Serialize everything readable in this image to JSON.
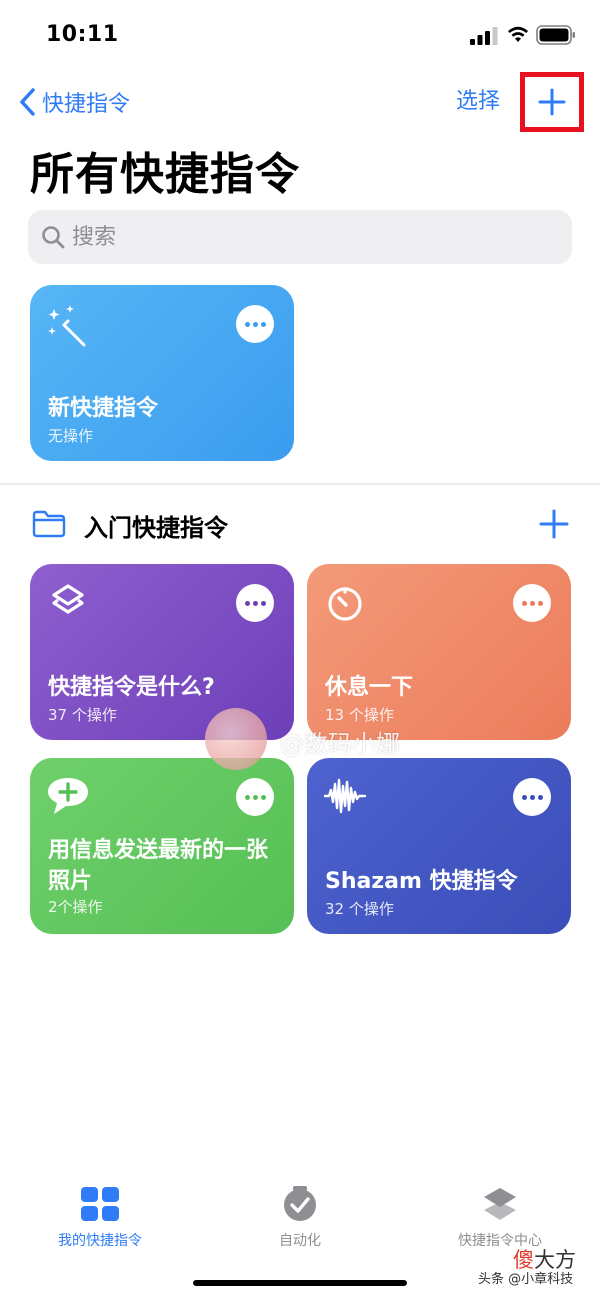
{
  "status_bar": {
    "time": "10:11"
  },
  "nav": {
    "back_label": "快捷指令",
    "select_label": "选择"
  },
  "page_title": "所有快捷指令",
  "search": {
    "placeholder": "搜索"
  },
  "top_card": {
    "title": "新快捷指令",
    "subtitle": "无操作",
    "color": "#4aaaf3",
    "icon": "sparkles-icon"
  },
  "section": {
    "title": "入门快捷指令",
    "icon": "folder-icon"
  },
  "cards": [
    {
      "title": "快捷指令是什么?",
      "subtitle": "37 个操作",
      "color": "#7d4fc4",
      "icon": "layers-icon"
    },
    {
      "title": "休息一下",
      "subtitle": "13 个操作",
      "color": "#f08b6a",
      "icon": "timer-icon"
    },
    {
      "title": "用信息发送最新的一张照片",
      "subtitle": "2个操作",
      "color": "#62c761",
      "icon": "message-plus-icon"
    },
    {
      "title": "Shazam 快捷指令",
      "subtitle": "32 个操作",
      "color": "#4457c4",
      "icon": "waveform-icon"
    }
  ],
  "watermark": {
    "text": "@数码小娜"
  },
  "tabs": [
    {
      "label": "我的快捷指令",
      "icon": "grid-icon",
      "active": true
    },
    {
      "label": "自动化",
      "icon": "clock-check-icon",
      "active": false
    },
    {
      "label": "快捷指令中心",
      "icon": "stack-icon",
      "active": false
    }
  ],
  "corner": {
    "logo_part1": "傻",
    "logo_part2": "大方",
    "credit": "头条 @小章科技"
  },
  "colors": {
    "accent": "#2f7cf6",
    "highlight_box": "#e8121f"
  }
}
